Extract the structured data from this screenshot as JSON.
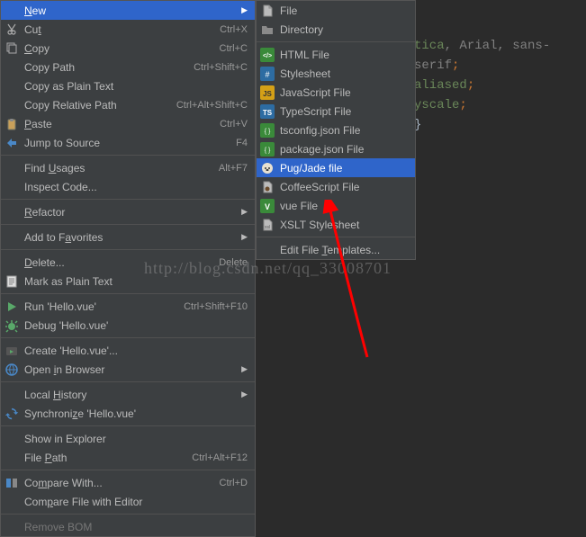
{
  "editor": {
    "line1a": "tica",
    "line1b": ", Arial",
    "line1c": ", sans-serif",
    "line1d": ";",
    "line2": "aliased",
    "line2b": ";",
    "line3": "yscale",
    "line3b": ";",
    "line4": "}"
  },
  "context_menu": [
    {
      "type": "item",
      "icon": "blank",
      "label": "<u>N</u>ew",
      "shortcut": "",
      "arrow": true,
      "highlighted": true
    },
    {
      "type": "item",
      "icon": "cut",
      "label": "Cu<u>t</u>",
      "shortcut": "Ctrl+X"
    },
    {
      "type": "item",
      "icon": "copy",
      "label": "<u>C</u>opy",
      "shortcut": "Ctrl+C"
    },
    {
      "type": "item",
      "icon": "blank",
      "label": "Copy Path",
      "shortcut": "Ctrl+Shift+C"
    },
    {
      "type": "item",
      "icon": "blank",
      "label": "Copy as Plain Text",
      "shortcut": ""
    },
    {
      "type": "item",
      "icon": "blank",
      "label": "Copy Relative Path",
      "shortcut": "Ctrl+Alt+Shift+C"
    },
    {
      "type": "item",
      "icon": "paste",
      "label": "<u>P</u>aste",
      "shortcut": "Ctrl+V"
    },
    {
      "type": "item",
      "icon": "jump",
      "label": "Jump to Source",
      "shortcut": "F4"
    },
    {
      "type": "sep"
    },
    {
      "type": "item",
      "icon": "blank",
      "label": "Find <u>U</u>sages",
      "shortcut": "Alt+F7"
    },
    {
      "type": "item",
      "icon": "blank",
      "label": "Inspect Code...",
      "shortcut": ""
    },
    {
      "type": "sep"
    },
    {
      "type": "item",
      "icon": "blank",
      "label": "<u>R</u>efactor",
      "shortcut": "",
      "arrow": true
    },
    {
      "type": "sep"
    },
    {
      "type": "item",
      "icon": "blank",
      "label": "Add to F<u>a</u>vorites",
      "shortcut": "",
      "arrow": true
    },
    {
      "type": "sep"
    },
    {
      "type": "item",
      "icon": "blank",
      "label": "<u>D</u>elete...",
      "shortcut": "Delete"
    },
    {
      "type": "item",
      "icon": "mark",
      "label": "Mark as Plain Text",
      "shortcut": ""
    },
    {
      "type": "sep"
    },
    {
      "type": "item",
      "icon": "run",
      "label": "Run 'Hello.vue'",
      "shortcut": "Ctrl+Shift+F10"
    },
    {
      "type": "item",
      "icon": "debug",
      "label": "Debug 'Hello.vue'",
      "shortcut": ""
    },
    {
      "type": "sep"
    },
    {
      "type": "item",
      "icon": "runconfig",
      "label": "Create 'Hello.vue'...",
      "shortcut": ""
    },
    {
      "type": "item",
      "icon": "browser",
      "label": "Open <u>i</u>n Browser",
      "shortcut": "",
      "arrow": true
    },
    {
      "type": "sep"
    },
    {
      "type": "item",
      "icon": "blank",
      "label": "Local <u>H</u>istory",
      "shortcut": "",
      "arrow": true
    },
    {
      "type": "item",
      "icon": "sync",
      "label": "Synchroni<u>z</u>e 'Hello.vue'",
      "shortcut": ""
    },
    {
      "type": "sep"
    },
    {
      "type": "item",
      "icon": "blank",
      "label": "Show in Explorer",
      "shortcut": ""
    },
    {
      "type": "item",
      "icon": "blank",
      "label": "File <u>P</u>ath",
      "shortcut": "Ctrl+Alt+F12"
    },
    {
      "type": "sep"
    },
    {
      "type": "item",
      "icon": "compare",
      "label": "Co<u>m</u>pare With...",
      "shortcut": "Ctrl+D"
    },
    {
      "type": "item",
      "icon": "blank",
      "label": "Com<u>p</u>are File with Editor",
      "shortcut": ""
    },
    {
      "type": "sep"
    },
    {
      "type": "item",
      "icon": "blank",
      "label": "Remove BOM",
      "shortcut": "",
      "disabled": true
    }
  ],
  "new_submenu": [
    {
      "icon": "file",
      "label": "File"
    },
    {
      "icon": "dir",
      "label": "Directory"
    },
    {
      "type": "sep"
    },
    {
      "icon": "html",
      "label": "HTML File"
    },
    {
      "icon": "css",
      "label": "Stylesheet"
    },
    {
      "icon": "js",
      "label": "JavaScript File"
    },
    {
      "icon": "ts",
      "label": "TypeScript File"
    },
    {
      "icon": "json",
      "label": "tsconfig.json File"
    },
    {
      "icon": "json",
      "label": "package.json File"
    },
    {
      "icon": "pug",
      "label": "Pug/Jade file",
      "highlighted": true
    },
    {
      "icon": "coffee",
      "label": "CoffeeScript File"
    },
    {
      "icon": "vue",
      "label": "vue File"
    },
    {
      "icon": "xslt",
      "label": "XSLT Stylesheet"
    },
    {
      "type": "sep"
    },
    {
      "icon": "blank",
      "label": "Edit File <u>T</u>emplates..."
    }
  ],
  "watermark": "http://blog.csdn.net/qq_33008701"
}
